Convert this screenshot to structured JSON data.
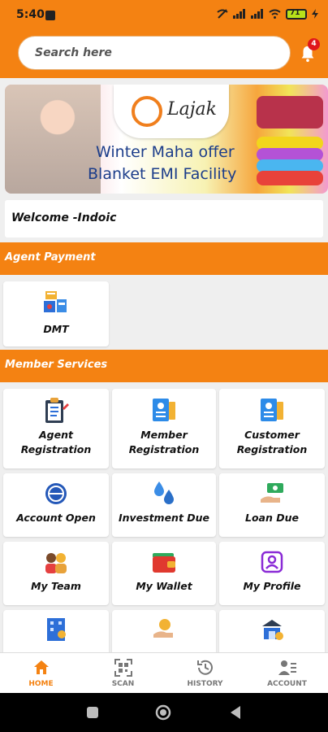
{
  "status_bar": {
    "time": "5:40",
    "battery": "71"
  },
  "header": {
    "search_placeholder": "Search here",
    "notification_count": "4"
  },
  "banner": {
    "brand": "Lajak",
    "line1": "Winter Maha offer",
    "line2": "Blanket EMI Facility"
  },
  "welcome_text": "Welcome -Indoic",
  "agent_payment": {
    "title": "Agent Payment",
    "items": [
      {
        "label": "DMT",
        "icon": "dmt-icon"
      }
    ]
  },
  "member_services": {
    "title": "Member Services",
    "items": [
      {
        "label_1": "Agent",
        "label_2": "Registration",
        "icon": "clipboard-pen-icon"
      },
      {
        "label_1": "Member",
        "label_2": "Registration",
        "icon": "id-card-icon"
      },
      {
        "label_1": "Customer",
        "label_2": "Registration",
        "icon": "id-card-icon"
      },
      {
        "label": "Account Open",
        "icon": "globe-icon"
      },
      {
        "label": "Investment Due",
        "icon": "water-drops-icon"
      },
      {
        "label": "Loan Due",
        "icon": "money-hand-icon"
      },
      {
        "label": "My Team",
        "icon": "team-icon"
      },
      {
        "label": "My Wallet",
        "icon": "wallet-icon"
      },
      {
        "label": "My Profile",
        "icon": "profile-icon"
      }
    ]
  },
  "bottom_nav": [
    {
      "label": "HOME",
      "icon": "home-icon",
      "active": true
    },
    {
      "label": "SCAN",
      "icon": "qr-scan-icon"
    },
    {
      "label": "HISTORY",
      "icon": "history-icon"
    },
    {
      "label": "ACCOUNT",
      "icon": "account-icon"
    }
  ],
  "colors": {
    "accent": "#f48212",
    "badge": "#e0161b",
    "background": "#efefef"
  }
}
